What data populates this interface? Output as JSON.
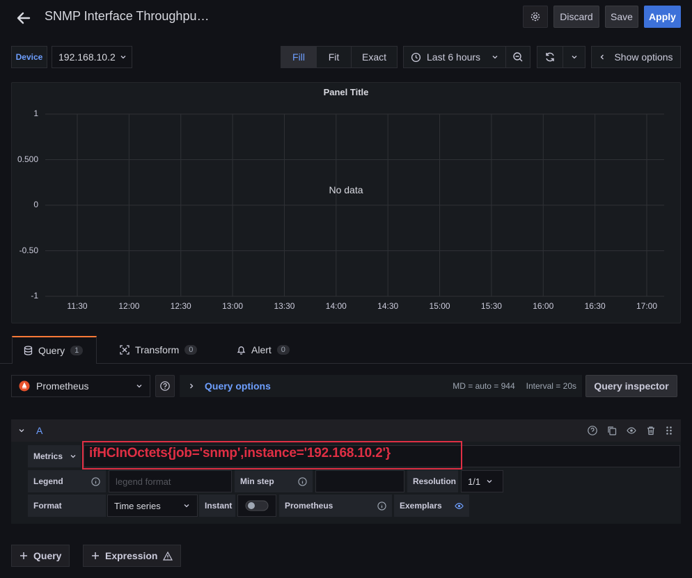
{
  "header": {
    "title": "SNMP Interface Throughpu…",
    "discard_label": "Discard",
    "save_label": "Save",
    "apply_label": "Apply"
  },
  "toolbar": {
    "variable_label": "Device",
    "variable_value": "192.168.10.2",
    "view_modes": [
      "Fill",
      "Fit",
      "Exact"
    ],
    "time_range": "Last 6 hours",
    "show_options_label": "Show options"
  },
  "panel": {
    "title": "Panel Title",
    "no_data": "No data"
  },
  "chart_data": {
    "type": "line",
    "title": "Panel Title",
    "yticks": [
      "1",
      "0.500",
      "0",
      "-0.50",
      "-1"
    ],
    "ylim": [
      -1,
      1
    ],
    "xticks": [
      "11:30",
      "12:00",
      "12:30",
      "13:00",
      "13:30",
      "14:00",
      "14:30",
      "15:00",
      "15:30",
      "16:00",
      "16:30",
      "17:00"
    ],
    "series": [],
    "grid": true
  },
  "tabs": [
    {
      "label": "Query",
      "count": "1"
    },
    {
      "label": "Transform",
      "count": "0"
    },
    {
      "label": "Alert",
      "count": "0"
    }
  ],
  "query": {
    "datasource": "Prometheus",
    "options_label": "Query options",
    "md_info": "MD = auto = 944",
    "interval_info": "Interval = 20s",
    "inspector_label": "Query inspector",
    "ref_id": "A",
    "metrics_label": "Metrics",
    "metrics_value": "ifHCInOctets{job='snmp',instance='192.168.10.2'}",
    "legend_label": "Legend",
    "legend_placeholder": "legend format",
    "min_step_label": "Min step",
    "resolution_label": "Resolution",
    "resolution_value": "1/1",
    "format_label": "Format",
    "format_value": "Time series",
    "instant_label": "Instant",
    "prometheus_label": "Prometheus",
    "exemplars_label": "Exemplars",
    "add_query_label": "Query",
    "add_expression_label": "Expression"
  }
}
